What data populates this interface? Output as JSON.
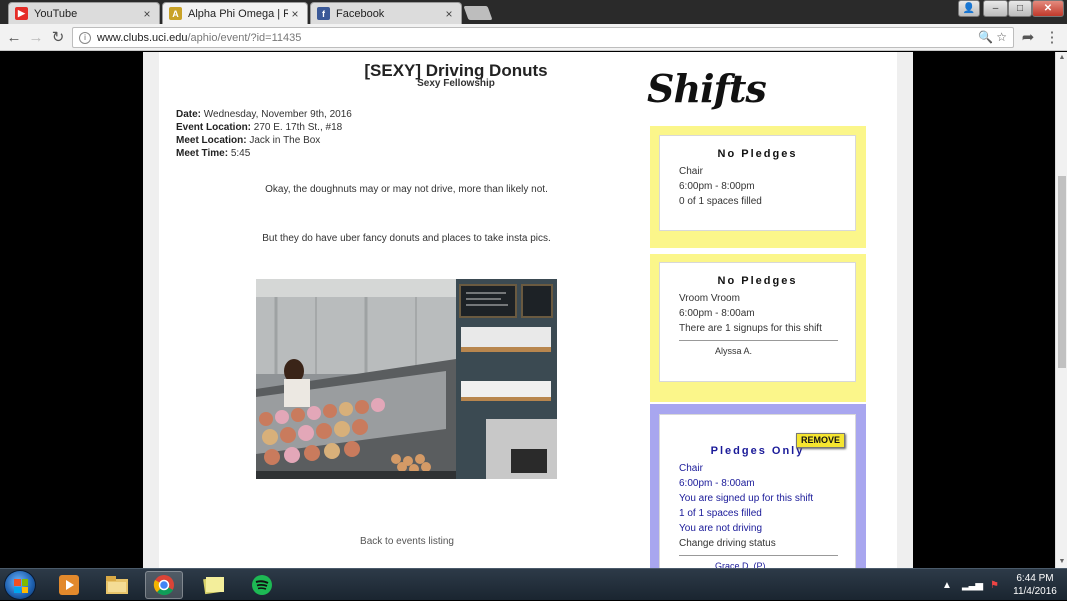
{
  "browser": {
    "tabs": [
      {
        "title": "YouTube",
        "icon": "youtube-icon",
        "color": "#e52d27"
      },
      {
        "title": "Alpha Phi Omega | Rho P",
        "icon": "apo-favicon-icon",
        "color": "#c9a227"
      },
      {
        "title": "Facebook",
        "icon": "facebook-icon",
        "color": "#3b5998"
      }
    ],
    "url_host": "www.clubs.uci.edu",
    "url_path": "/aphio/event/?id=11435"
  },
  "event": {
    "title": "[SEXY] Driving Donuts",
    "subtitle": "Sexy Fellowship",
    "date_label": "Date:",
    "date": "Wednesday, November 9th, 2016",
    "location_label": "Event Location:",
    "location": "270 E. 17th St., #18",
    "meet_location_label": "Meet Location:",
    "meet_location": "Jack in The Box",
    "meet_time_label": "Meet Time:",
    "meet_time": "5:45",
    "description_1": "Okay, the doughnuts may or may not drive, more than likely not.",
    "description_2": "But they do have uber fancy donuts and places to take insta pics.",
    "back_link": "Back to events listing"
  },
  "shifts": {
    "heading": "Shifts",
    "items": [
      {
        "header": "No Pledges",
        "role": "Chair",
        "time": "6:00pm - 8:00pm",
        "status": "0 of 1 spaces filled",
        "color": "#fbf68a"
      },
      {
        "header": "No Pledges",
        "role": "Vroom Vroom",
        "time": "6:00pm - 8:00am",
        "status": "There are 1 signups for this shift",
        "signup": "Alyssa A.",
        "color": "#fbf68a"
      },
      {
        "header": "Pledges Only",
        "remove_label": "REMOVE",
        "role": "Chair",
        "time": "6:00pm - 8:00am",
        "signed_up": "You are signed up for this shift",
        "status": "1 of 1 spaces filled",
        "driving": "You are not driving",
        "change_driving": "Change driving status",
        "signup": "Grace D. (P)",
        "color": "#a8a6ef"
      }
    ]
  },
  "taskbar": {
    "time": "6:44 PM",
    "date": "11/4/2016"
  }
}
